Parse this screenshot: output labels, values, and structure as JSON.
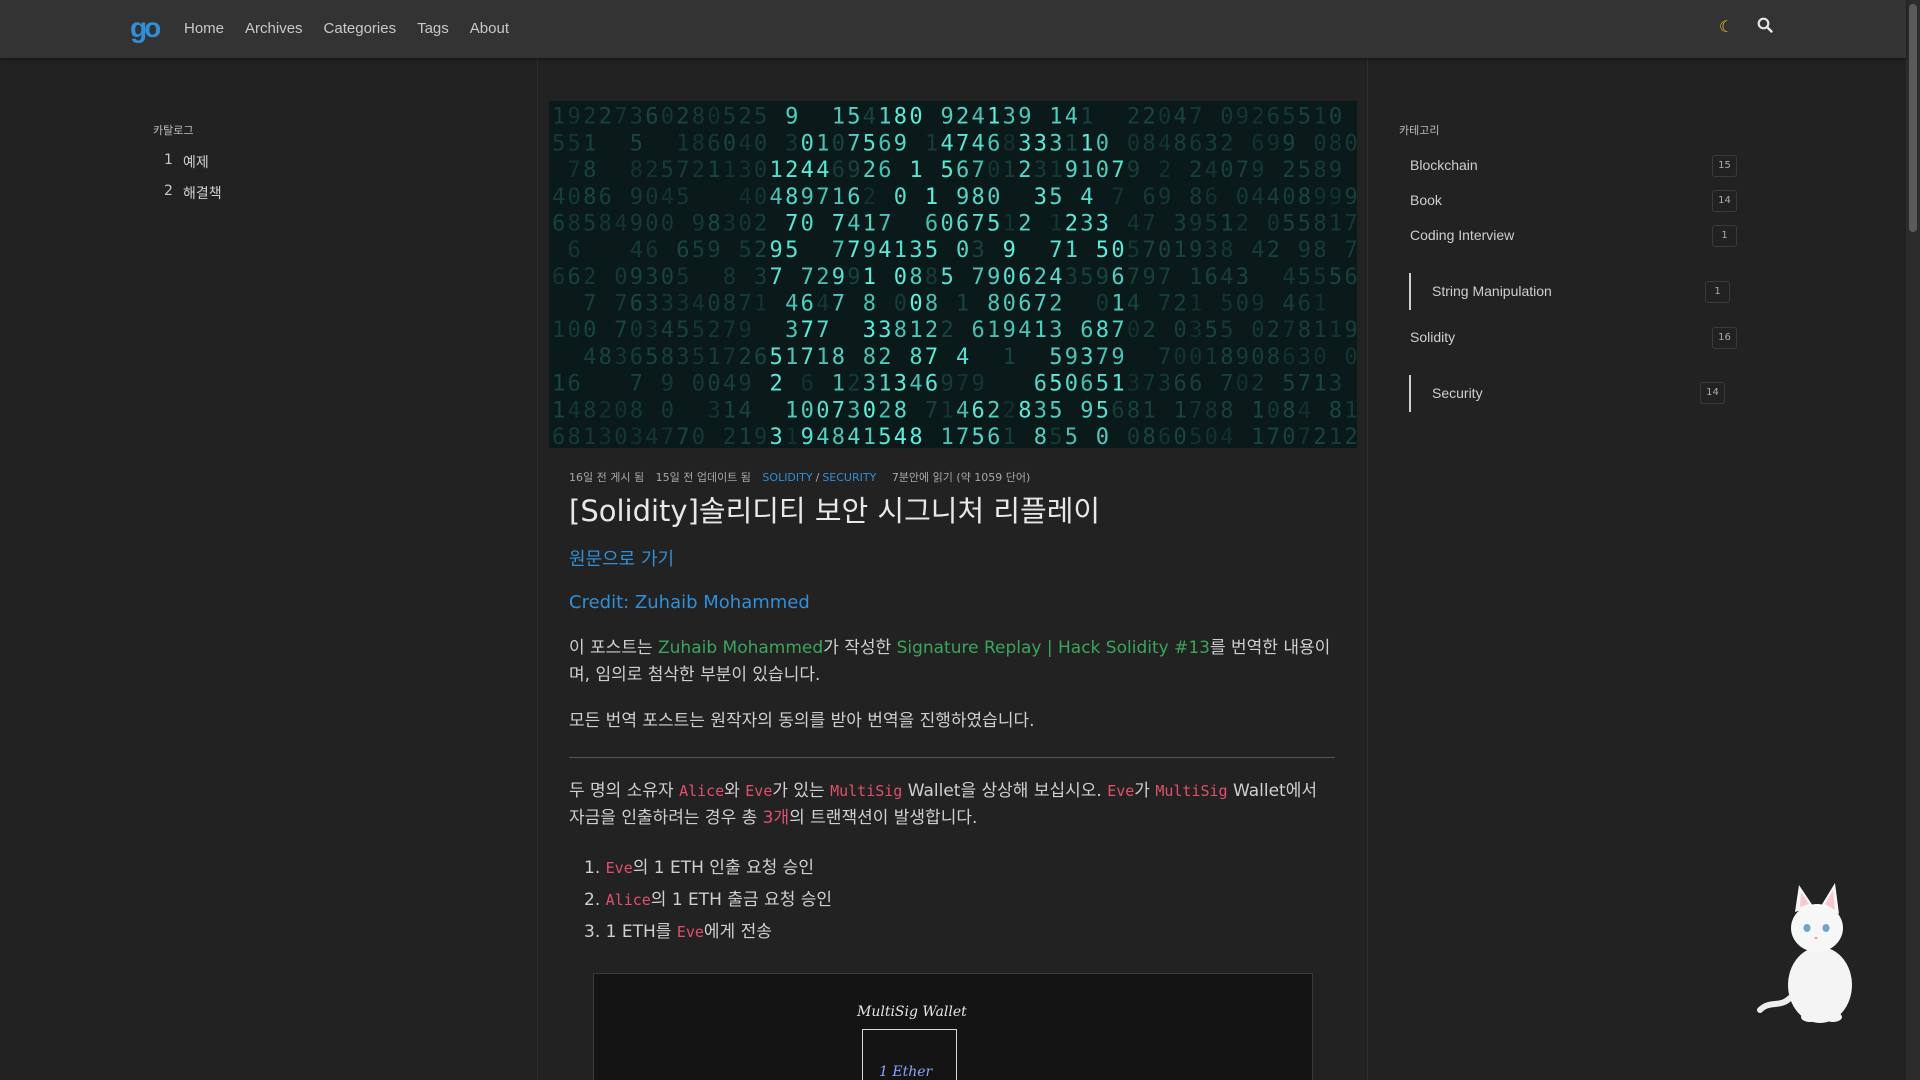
{
  "header": {
    "logo_text": "go",
    "nav": [
      {
        "label": "Home"
      },
      {
        "label": "Archives"
      },
      {
        "label": "Categories"
      },
      {
        "label": "Tags"
      },
      {
        "label": "About"
      }
    ],
    "moon_icon": "☾",
    "search_icon": "search-icon"
  },
  "toc": {
    "title": "카탈로그",
    "items": [
      {
        "num": "1",
        "label": "예제"
      },
      {
        "num": "2",
        "label": "해결책"
      }
    ]
  },
  "categories": {
    "title": "카테고리",
    "items": [
      {
        "label": "Blockchain",
        "count": "15"
      },
      {
        "label": "Book",
        "count": "14"
      },
      {
        "label": "Coding Interview",
        "count": "1"
      },
      {
        "label": "String Manipulation",
        "count": "1"
      },
      {
        "label": "Solidity",
        "count": "16"
      },
      {
        "label": "Security",
        "count": "14"
      }
    ]
  },
  "post": {
    "meta": {
      "posted": "16일 전 게시 됨",
      "updated": "15일 전 업데이트 됨",
      "cat1": "SOLIDITY",
      "sep": "/",
      "cat2": "SECURITY",
      "read": "7분안에 읽기 (약 1059 단어)"
    },
    "title": "[Solidity]솔리디티 보안 시그니처 리플레이",
    "original_link": "원문으로 가기",
    "credit": "Credit: Zuhaib Mohammed",
    "intro": {
      "p1": "이 포스트는 ",
      "author": "Zuhaib Mohammed",
      "p2": "가 작성한 ",
      "source": "Signature Replay | Hack Solidity #13",
      "p3": "를 번역한 내용이며, 임의로 첨삭한 부분이 있습니다."
    },
    "consent": "모든 번역 포스트는 원작자의 동의를 받아 번역을 진행하였습니다.",
    "body": {
      "t1": "두 명의 소유자 ",
      "alice": "Alice",
      "t2": "와 ",
      "eve": "Eve",
      "t3": "가 있는 ",
      "multisig": "MultiSig",
      "t4": " Wallet을 상상해 보십시오. ",
      "eve2": "Eve",
      "t5": "가 ",
      "multisig2": "MultiSig",
      "t6": " Wallet에서 자금을 인출하려는 경우 총 ",
      "three": "3개",
      "t7": "의 트랜잭션이 발생합니다."
    },
    "steps": [
      {
        "num": "1.",
        "code": "Eve",
        "text": "의 1 ETH 인출 요청 승인",
        "prefix": ""
      },
      {
        "num": "2.",
        "code": "Alice",
        "text": "의 1 ETH 출금 요청 승인",
        "prefix": ""
      },
      {
        "num": "3.",
        "code": "Eve",
        "text": "에게 전송",
        "prefix": "1 ETH를 "
      }
    ],
    "diagram": {
      "label": "MultiSig Wallet",
      "ether": "1 Ether"
    }
  },
  "colors": {
    "accent": "#2f8fd8",
    "link_green": "#3ba55c",
    "code_red": "#e0506a",
    "background": "#222222",
    "header": "#333333"
  }
}
